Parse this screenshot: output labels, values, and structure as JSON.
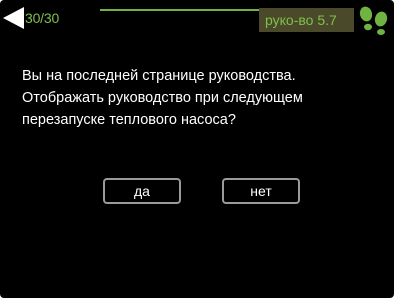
{
  "header": {
    "page_counter": "30/30",
    "guide_label": "руко-во 5.7",
    "back_icon": "back-arrow-icon",
    "status_icon": "footprints-icon",
    "accent_color": "#7fbf4c",
    "badge_color": "#4a4a2a"
  },
  "message": {
    "lines": [
      "Вы на последней странице руководства.",
      "Отображать руководство при следующем",
      "перезапуске теплового насоса?"
    ]
  },
  "buttons": {
    "yes_label": "да",
    "no_label": "нет"
  }
}
